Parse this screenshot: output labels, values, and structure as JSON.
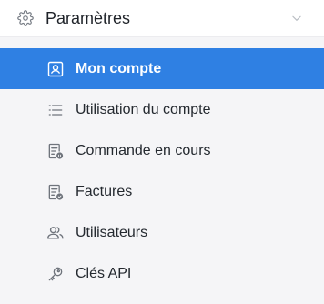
{
  "header": {
    "title": "Paramètres",
    "icon": "gear-icon",
    "toggle_icon": "chevron-down-icon"
  },
  "items": [
    {
      "label": "Mon compte",
      "icon": "account-card-icon",
      "active": true
    },
    {
      "label": "Utilisation du compte",
      "icon": "list-icon",
      "active": false
    },
    {
      "label": "Commande en cours",
      "icon": "order-pending-icon",
      "active": false
    },
    {
      "label": "Factures",
      "icon": "invoice-check-icon",
      "active": false
    },
    {
      "label": "Utilisateurs",
      "icon": "users-icon",
      "active": false
    },
    {
      "label": "Clés API",
      "icon": "key-icon",
      "active": false
    }
  ],
  "colors": {
    "active_background": "#2f80e3",
    "active_text": "#ffffff",
    "menu_background": "#f5f5f7",
    "header_background": "#ffffff"
  }
}
